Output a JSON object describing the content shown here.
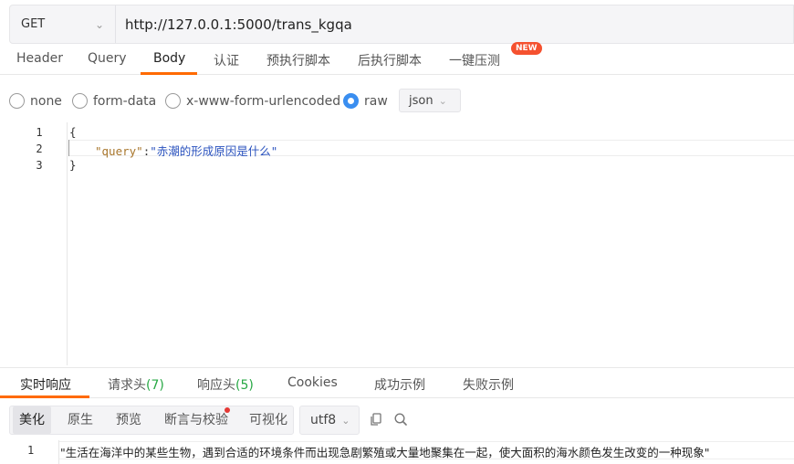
{
  "request": {
    "method": "GET",
    "url": "http://127.0.0.1:5000/trans_kgqa"
  },
  "request_tabs": {
    "header": "Header",
    "query": "Query",
    "body": "Body",
    "auth": "认证",
    "pre_script": "预执行脚本",
    "post_script": "后执行脚本",
    "stress_test": "一键压测",
    "new_badge": "NEW",
    "active": "Body"
  },
  "body_types": {
    "none": "none",
    "form_data": "form-data",
    "urlencoded": "x-www-form-urlencoded",
    "raw": "raw",
    "selected": "raw",
    "format": "json"
  },
  "editor": {
    "line_numbers": [
      "1",
      "2",
      "3"
    ],
    "line1": "{",
    "line2_key": "\"query\"",
    "line2_colon": ":",
    "line2_value": "\"赤潮的形成原因是什么\"",
    "line3": "}"
  },
  "response_tabs": {
    "realtime": "实时响应",
    "req_headers": "请求头",
    "req_headers_count": "(7)",
    "resp_headers": "响应头",
    "resp_headers_count": "(5)",
    "cookies": "Cookies",
    "success_example": "成功示例",
    "fail_example": "失败示例",
    "active": "实时响应"
  },
  "response_view": {
    "beautify": "美化",
    "raw": "原生",
    "preview": "预览",
    "assert": "断言与校验",
    "visualize": "可视化",
    "encoding": "utf8",
    "active": "美化"
  },
  "response_output": {
    "line_number": "1",
    "text": "\"生活在海洋中的某些生物，遇到合适的环境条件而出现急剧繁殖或大量地聚集在一起，使大面积的海水颜色发生改变的一种现象\""
  },
  "colors": {
    "accent": "#ff6a00",
    "radio_checked": "#3a8ef0",
    "badge": "#f5512f",
    "count_green": "#27a844",
    "json_key": "#a8762c",
    "json_string": "#2a52be"
  }
}
